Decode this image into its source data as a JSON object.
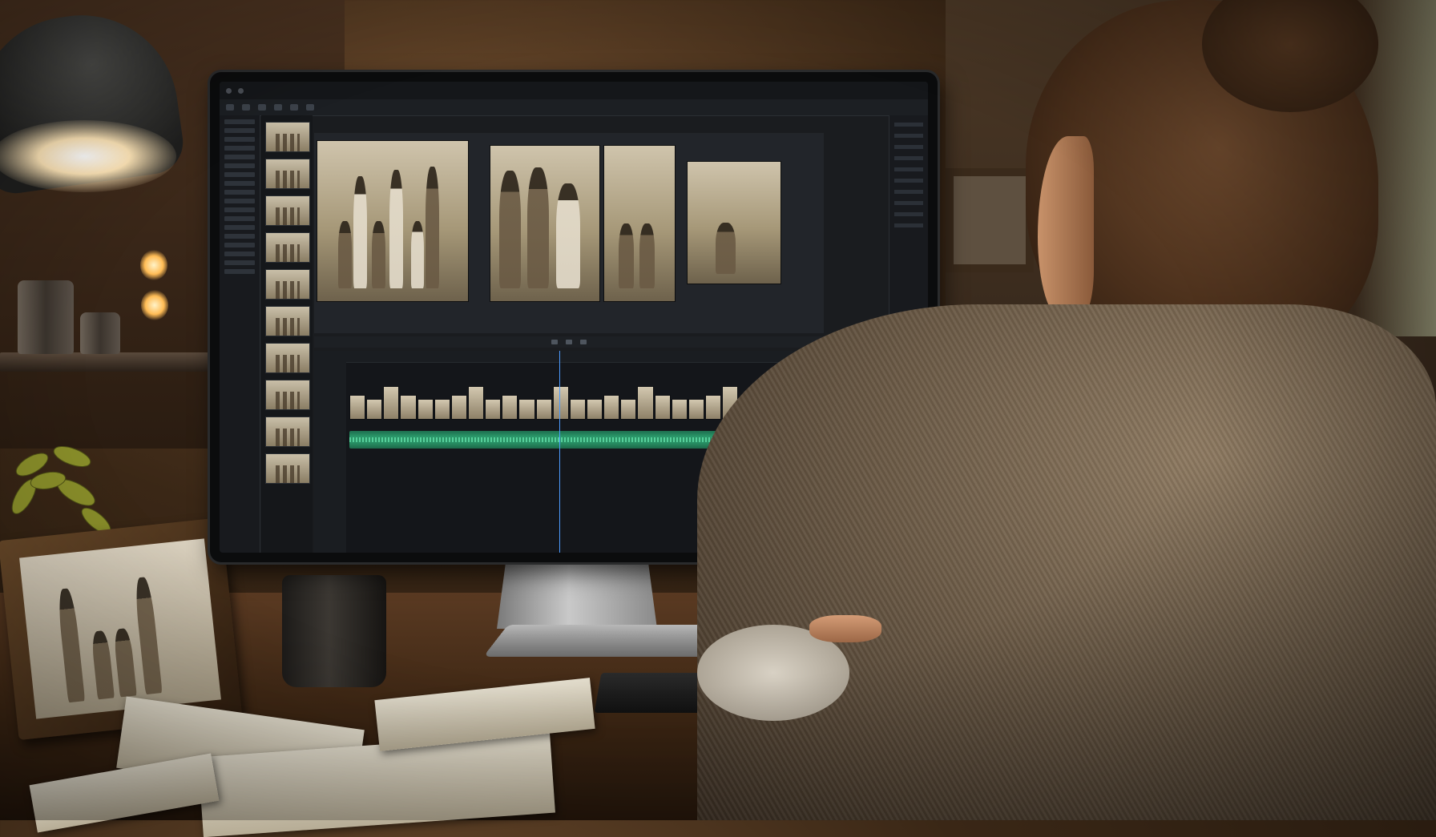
{
  "scene": {
    "description_colors": {
      "warm_light": "#ffbc55",
      "timeline_accent": "#3f7fd0",
      "audio_green": "#2fa774",
      "sepia": "#a69878"
    }
  },
  "editor": {
    "app_name": "",
    "thumbnail_count": 10,
    "viewer_photos": 4,
    "timeline_clip_count": 34
  }
}
